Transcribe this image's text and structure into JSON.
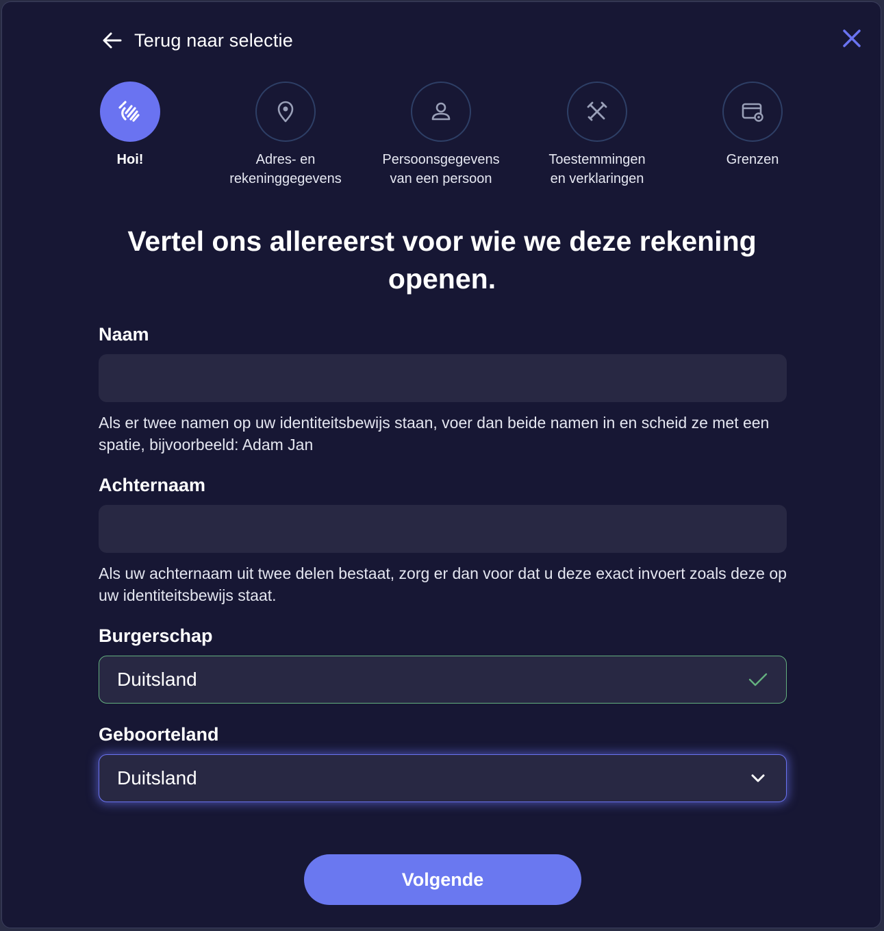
{
  "header": {
    "back_label": "Terug naar selectie",
    "back_icon": "arrow-left-icon",
    "close_icon": "close-icon"
  },
  "steps": [
    {
      "label": "Hoi!",
      "icon": "wave-hand-icon",
      "active": true
    },
    {
      "label": "Adres- en\nrekeninggegevens",
      "icon": "location-pin-icon",
      "active": false
    },
    {
      "label": "Persoonsgegevens\nvan een persoon",
      "icon": "person-icon",
      "active": false
    },
    {
      "label": "Toestemmingen\nen verklaringen",
      "icon": "tools-icon",
      "active": false
    },
    {
      "label": "Grenzen",
      "icon": "card-settings-icon",
      "active": false
    }
  ],
  "heading": "Vertel ons allereerst voor wie we deze rekening openen.",
  "form": {
    "naam": {
      "label": "Naam",
      "value": "",
      "hint": "Als er twee namen op uw identiteitsbewijs staan, voer dan beide namen in en scheid ze met een spatie, bijvoorbeeld: Adam Jan"
    },
    "achternaam": {
      "label": "Achternaam",
      "value": "",
      "hint": "Als uw achternaam uit twee delen bestaat, zorg er dan voor dat u deze exact invoert zoals deze op uw identiteitsbewijs staat."
    },
    "burgerschap": {
      "label": "Burgerschap",
      "value": "Duitsland",
      "state": "valid",
      "icon": "checkmark-icon"
    },
    "geboorteland": {
      "label": "Geboorteland",
      "value": "Duitsland",
      "state": "focused",
      "icon": "chevron-down-icon"
    }
  },
  "next_button": "Volgende",
  "colors": {
    "background": "#171734",
    "accent": "#6a73f1",
    "field": "#282843",
    "valid": "#64b17f"
  }
}
